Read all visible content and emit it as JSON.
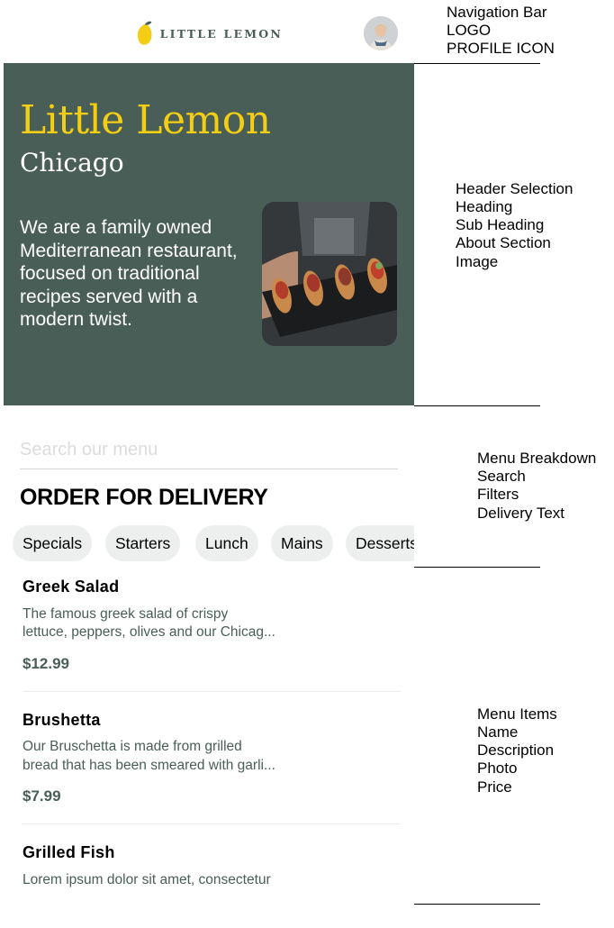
{
  "nav": {
    "logo_text": "LITTLE LEMON"
  },
  "hero": {
    "title": "Little Lemon",
    "subtitle": "Chicago",
    "description": "We are a family owned Mediterranean restaurant, focused on traditional recipes served with a modern twist."
  },
  "search": {
    "placeholder": "Search our menu"
  },
  "delivery_heading": "ORDER FOR DELIVERY",
  "filters": [
    "Specials",
    "Starters",
    "Lunch",
    "Mains",
    "Desserts"
  ],
  "menu_items": [
    {
      "name": "Greek Salad",
      "description_line1": "The famous greek salad of crispy",
      "description_line2": "lettuce, peppers, olives and our Chicag...",
      "price": "$12.99"
    },
    {
      "name": "Brushetta",
      "description_line1": "Our Bruschetta is made from grilled",
      "description_line2": "bread that has been smeared with garli...",
      "price": "$7.99"
    },
    {
      "name": "Grilled Fish",
      "description_line1": "Lorem ipsum dolor sit amet, consectetur"
    }
  ],
  "annotations": {
    "nav": [
      "Navigation Bar",
      "LOGO",
      "PROFILE ICON"
    ],
    "header": [
      "Header Selection",
      "Heading",
      "Sub Heading",
      "About Section",
      "Image"
    ],
    "menu_breakdown": [
      "Menu Breakdown",
      "Search",
      "Filters",
      "Delivery Text"
    ],
    "menu_items": [
      "Menu Items",
      "Name",
      "Description",
      "Photo",
      "Price"
    ]
  },
  "colors": {
    "primary_green": "#495e57",
    "primary_yellow": "#f4ce14",
    "chip_bg": "#edefee"
  }
}
